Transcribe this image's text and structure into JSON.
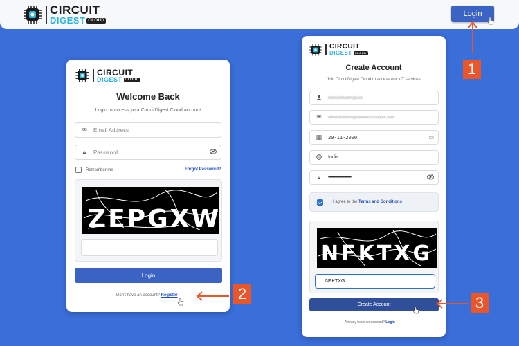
{
  "brand": {
    "word1": "CIRCUIT",
    "word2": "DIGEST",
    "tag": "CLOUD"
  },
  "nav": {
    "login_label": "Login"
  },
  "login_card": {
    "title": "Welcome Back",
    "subtitle": "Login to access your CircuitDigest Cloud account",
    "email_placeholder": "Email Address",
    "password_placeholder": "Password",
    "remember_label": "Remember me",
    "forgot_label": "Forgot Password?",
    "captcha_text": "ZEPGXW",
    "captcha_input_value": "",
    "login_button": "Login",
    "no_account_text": "Don't have an account?",
    "register_link": "Register"
  },
  "signup_card": {
    "title": "Create Account",
    "subtitle": "Join CircuitDigest Cloud to access our IoT services",
    "name_value": "nikhil.kmomn@xxx",
    "email_value": "nikhil.kmomn@xxxxxxxxxxxxxx.com",
    "dob_value": "20-11-2000",
    "country_value": "India",
    "password_value": "••••••••••••••••••••••••••••••",
    "terms_prefix": "I agree to the",
    "terms_link": "Terms and Conditions",
    "captcha_text": "NFKTXG",
    "captcha_input_value": "NFKTXG",
    "create_button": "Create Account",
    "have_account_text": "Already have an account?",
    "login_link": "Login"
  },
  "annotations": {
    "badge1": "1",
    "badge2": "2",
    "badge3": "3"
  },
  "colors": {
    "background": "#3a6ed8",
    "primary": "#3a63c4",
    "accent": "#e8562a",
    "brand_blue": "#2bb3e0"
  }
}
